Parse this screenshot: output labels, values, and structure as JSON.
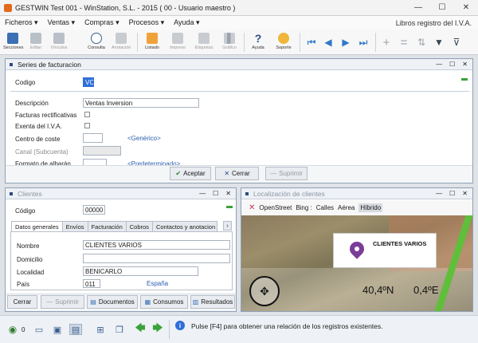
{
  "window": {
    "title": "GESTWIN  Test  001 - WinStation, S.L. - 2015 ( 00 - Usuario maestro )"
  },
  "menu": {
    "items": [
      "Ficheros ▾",
      "Ventas ▾",
      "Compras ▾",
      "Procesos ▾",
      "Ayuda ▾"
    ],
    "right": "Libros registro del I.V.A."
  },
  "toolbar": {
    "secciones": "Secciones",
    "editar": "Editar",
    "vinculos": "Vínculos",
    "consulta": "Consulta",
    "anotacion": "Anotación",
    "listado": "Listado",
    "impreso": "Impreso",
    "etiquetas": "Etiquetas",
    "grafico": "Gráfico",
    "ayuda": "Ayuda",
    "soporte": "Soporte"
  },
  "series": {
    "title": "Series de facturacion",
    "codigo_label": "Codigo",
    "codigo_value": "VC",
    "descripcion_label": "Descripción",
    "descripcion_value": "Ventas Inversion",
    "facturas_label": "Facturas rectificativas",
    "exenta_label": "Exenta del I.V.A.",
    "centro_label": "Centro de coste",
    "centro_link": "<Genérico>",
    "canal_label": "Canal (Subcuenta)",
    "formato_label": "Formato de albarán",
    "formato_link": "<Predeterminado>",
    "aceptar": "Aceptar",
    "cerrar": "Cerrar",
    "suprimir": "Suprimir"
  },
  "clientes": {
    "title": "Clientes",
    "codigo_label": "Código",
    "codigo_value": "00000",
    "tabs": [
      "Datos generales",
      "Envíos",
      "Facturación",
      "Cobros",
      "Contactos y anotacion"
    ],
    "nombre_label": "Nombre",
    "nombre_value": "CLIENTES VARIOS",
    "domicilio_label": "Domicilio",
    "localidad_label": "Localidad",
    "localidad_value": "BENICARLO",
    "pais_label": "País",
    "pais_value": "011",
    "pais_name": "España",
    "btn_cerrar": "Cerrar",
    "btn_suprimir": "Suprimir",
    "btn_documentos": "Documentos",
    "btn_consumos": "Consumos",
    "btn_resultados": "Resultados"
  },
  "mapa": {
    "title": "Localización de clientes",
    "openstreet": "OpenStreet",
    "bing": "Bing :",
    "calles": "Calles",
    "aerea": "Aérea",
    "hibrido": "Híbrido",
    "marker_label": "CLIENTES VARIOS",
    "lat": "40,4ºN",
    "lon": "0,4ºE"
  },
  "status": {
    "count": "0",
    "message": "Pulse [F4] para obtener una relación de los registros existentes."
  }
}
